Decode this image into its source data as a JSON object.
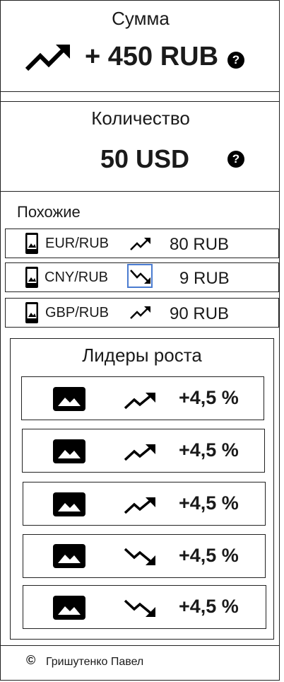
{
  "sum": {
    "title": "Сумма",
    "value": "+ 450 RUB",
    "help": "?"
  },
  "quantity": {
    "title": "Количество",
    "value": "50 USD",
    "help": "?"
  },
  "similar": {
    "title": "Похожие",
    "items": [
      {
        "pair": "EUR/RUB",
        "trend": "up",
        "value": "80 RUB"
      },
      {
        "pair": "CNY/RUB",
        "trend": "down",
        "value": "9 RUB"
      },
      {
        "pair": "GBP/RUB",
        "trend": "up",
        "value": "90 RUB"
      }
    ]
  },
  "leaders": {
    "title": "Лидеры роста",
    "items": [
      {
        "trend": "up",
        "value": "+4,5 %"
      },
      {
        "trend": "up",
        "value": "+4,5 %"
      },
      {
        "trend": "up",
        "value": "+4,5 %"
      },
      {
        "trend": "down",
        "value": "+4,5 %"
      },
      {
        "trend": "down",
        "value": "+4,5 %"
      }
    ]
  },
  "footer": {
    "copyright_symbol": "©",
    "author": "Гришутенко Павел"
  },
  "icons": {
    "trend_up": "trending-up-icon",
    "trend_down": "trending-down-icon",
    "phone": "smartphone-icon",
    "image": "image-icon",
    "help": "help-circle-icon"
  },
  "colors": {
    "focus_outline": "#4a7bd0"
  }
}
